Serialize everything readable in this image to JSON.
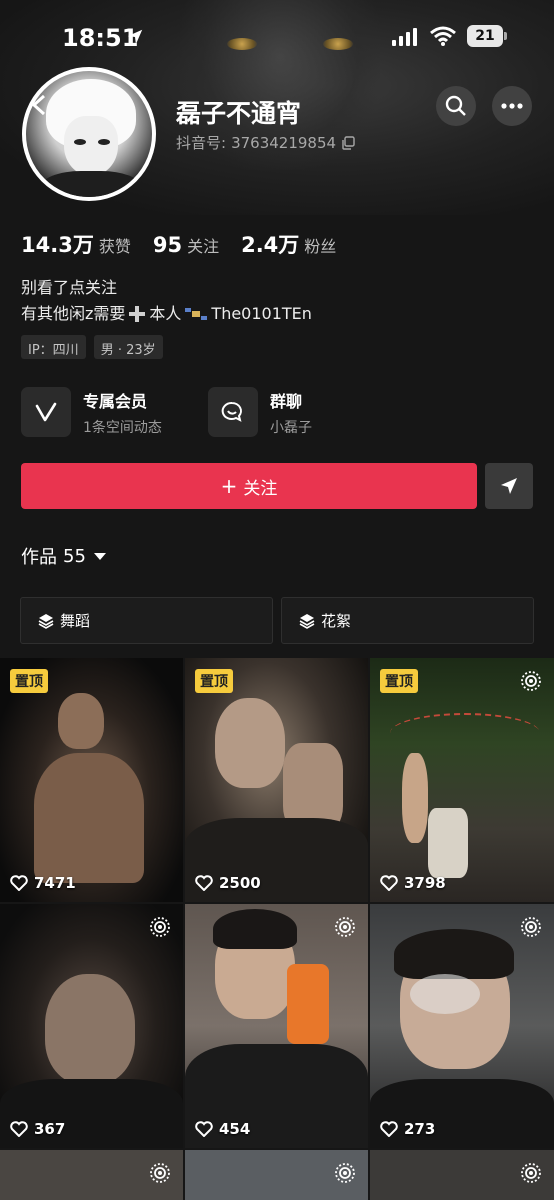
{
  "status_bar": {
    "time": "18:51",
    "battery": "21"
  },
  "profile": {
    "name": "磊子不通宵",
    "douyin_id_label": "抖音号:",
    "douyin_id": "37634219854"
  },
  "stats": [
    {
      "value": "14.3万",
      "label": "获赞"
    },
    {
      "value": "95",
      "label": "关注"
    },
    {
      "value": "2.4万",
      "label": "粉丝"
    }
  ],
  "bio": {
    "line1": "别看了点关注",
    "line2_prefix": "有其他闲z需要",
    "line2_mid": "本人",
    "line2_suffix": "The0101TEn"
  },
  "tags": [
    "IP：四川",
    "男 · 23岁"
  ],
  "features": {
    "vip": {
      "title": "专属会员",
      "subtitle": "1条空间动态"
    },
    "group": {
      "title": "群聊",
      "subtitle": "小磊子"
    }
  },
  "follow_button": "关注",
  "works": {
    "label": "作品",
    "count": "55"
  },
  "collections": [
    "舞蹈",
    "花絮"
  ],
  "pinned_label": "置顶",
  "videos": [
    {
      "likes": "7471",
      "pinned": true,
      "live": false
    },
    {
      "likes": "2500",
      "pinned": true,
      "live": false
    },
    {
      "likes": "3798",
      "pinned": true,
      "live": true
    },
    {
      "likes": "367",
      "pinned": false,
      "live": true
    },
    {
      "likes": "454",
      "pinned": false,
      "live": true
    },
    {
      "likes": "273",
      "pinned": false,
      "live": true
    }
  ],
  "colors": {
    "accent": "#e9344f",
    "pin": "#f6cb3d",
    "background": "#161616"
  }
}
